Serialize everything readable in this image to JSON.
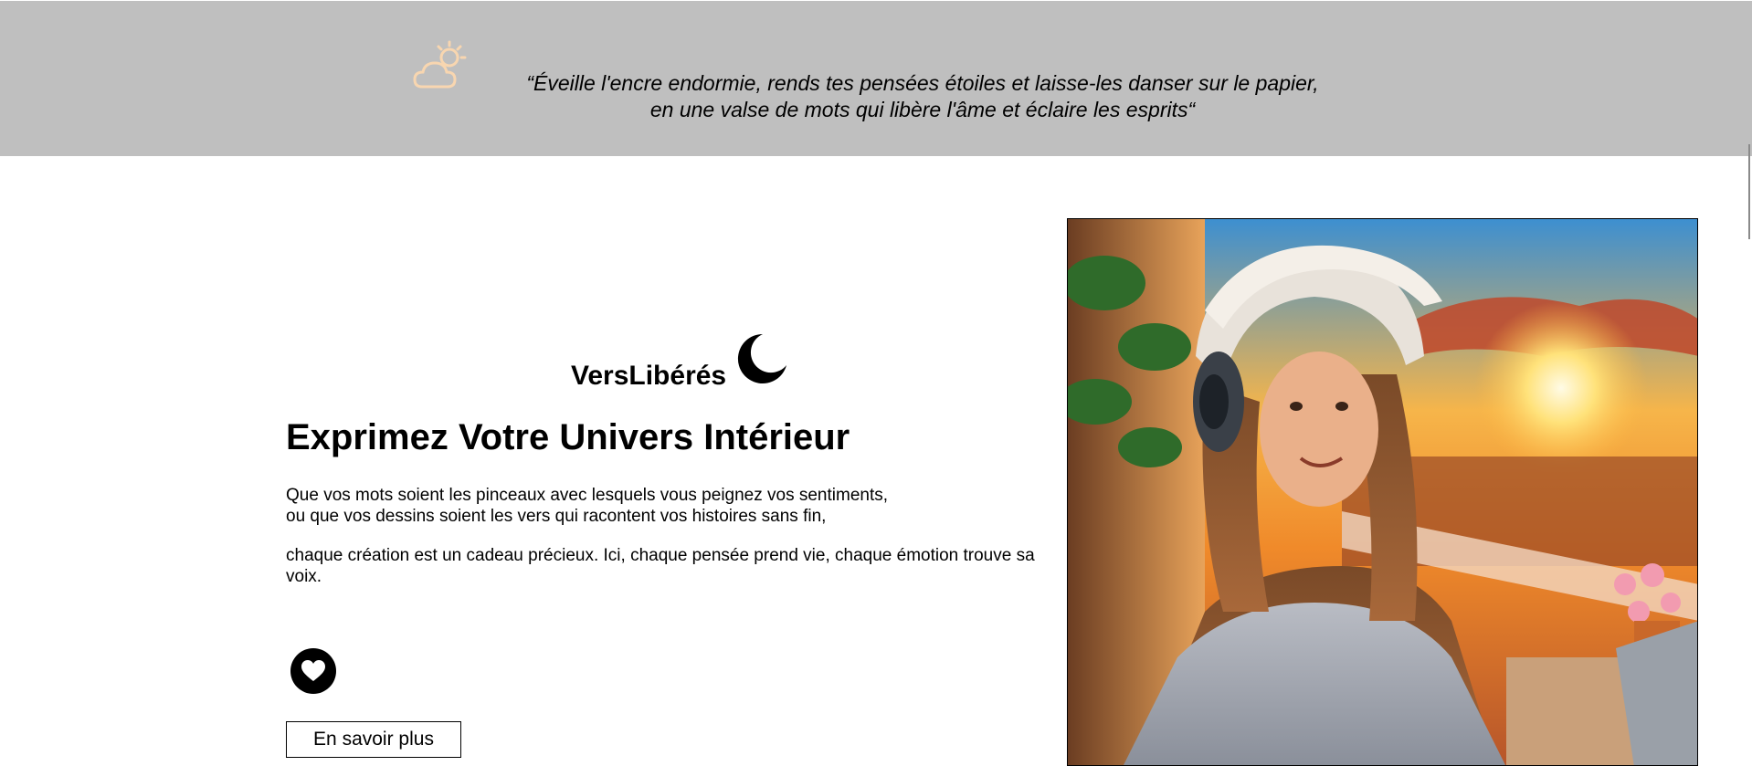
{
  "banner": {
    "icon": "sun-behind-cloud-icon",
    "icon_color": "#f8d6b0",
    "background": "#bfbfbf",
    "quote_line1": "“Éveille l'encre endormie, rends tes pensées étoiles et laisse-les danser sur le papier,",
    "quote_line2": "en une valse de mots qui libère l'âme et éclaire les esprits“"
  },
  "hero": {
    "brand": "VersLibérés",
    "brand_icon": "crescent-moon-icon",
    "headline": "Exprimez Votre Univers Intérieur",
    "paragraph1_line1": "Que vos mots soient les pinceaux avec lesquels vous peignez vos sentiments,",
    "paragraph1_line2": "ou que vos dessins soient les vers qui racontent vos histoires sans fin,",
    "paragraph2": "chaque création est un cadeau précieux. Ici, chaque pensée prend vie, chaque émotion trouve sa voix.",
    "like_icon": "heart-icon",
    "cta_label": "En savoir plus",
    "image_alt": "girl-with-helmet-at-sunset-illustration"
  }
}
